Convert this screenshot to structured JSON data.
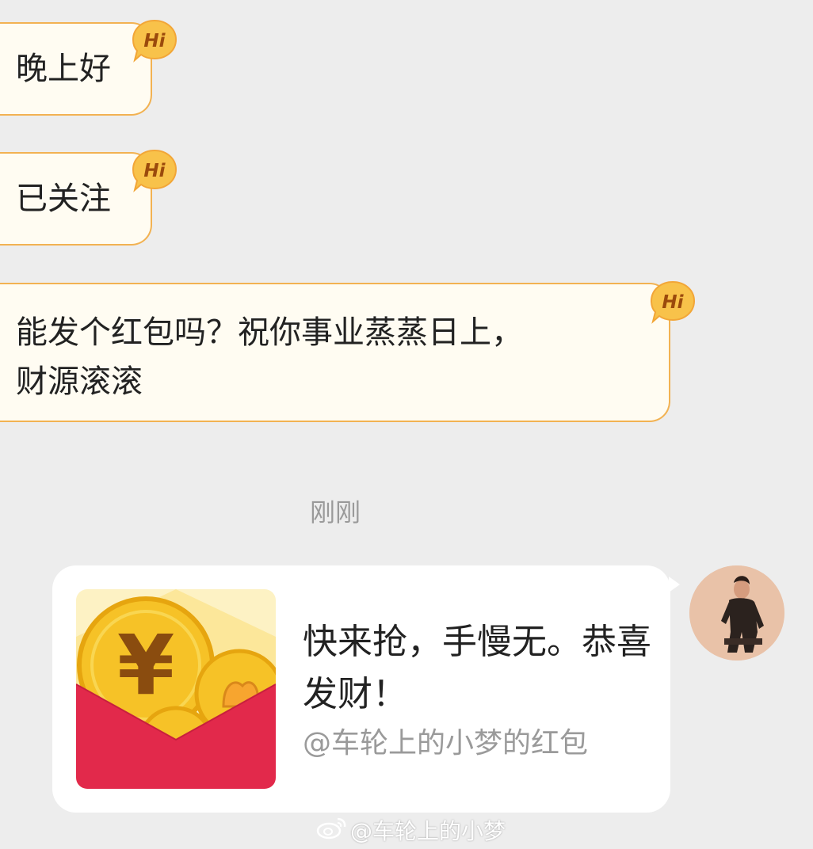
{
  "chat": {
    "messages": [
      {
        "text": "晚上好",
        "badge": "Hi"
      },
      {
        "text": "已关注",
        "badge": "Hi"
      },
      {
        "text": "能发个红包吗？祝你事业蒸蒸日上，\n财源滚滚",
        "badge": "Hi"
      }
    ],
    "timestamp": "刚刚",
    "red_packet": {
      "title": "快来抢，手慢无。恭喜发财！",
      "subtitle": "@车轮上的小梦的红包",
      "icon": "red-envelope-coin-icon"
    },
    "avatar_icon": "user-avatar-icon"
  },
  "watermark": {
    "text": "@车轮上的小梦",
    "icon": "weibo-logo-icon"
  },
  "colors": {
    "background": "#ededed",
    "bubble_fill": "#fffcf2",
    "bubble_border": "#f2b252",
    "badge": "#f6b53c",
    "envelope_red": "#e2294b",
    "coin_gold": "#f6c227",
    "muted_text": "#9a9a9a"
  }
}
